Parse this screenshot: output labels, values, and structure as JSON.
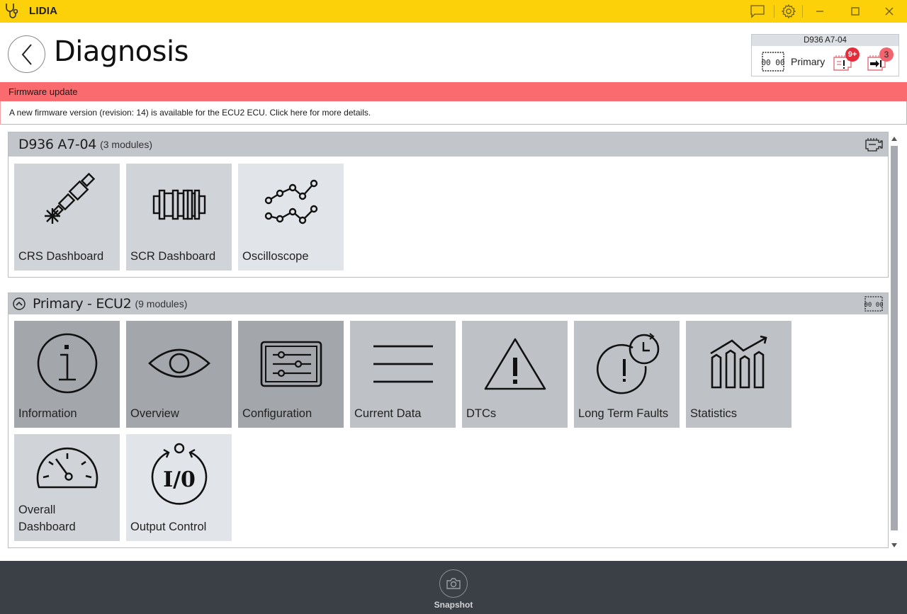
{
  "window": {
    "app_title": "LIDIA",
    "controls": {
      "feedback": "chat-icon",
      "settings": "gear-icon",
      "minimize": "minimize-icon",
      "maximize": "maximize-icon",
      "close": "close-icon"
    }
  },
  "header": {
    "page_title": "Diagnosis",
    "ecu_card": {
      "title": "D936 A7-04",
      "ecu_label": "Primary",
      "fault_badge": "9+",
      "output_badge": "3"
    }
  },
  "firmware_banner": {
    "title": "Firmware update",
    "message": "A new firmware version (revision: 14) is available for the ECU2 ECU. Click here for more details."
  },
  "sections": [
    {
      "title": "D936 A7-04",
      "count": "(3 modules)",
      "tiles": [
        {
          "label": "CRS Dashboard",
          "icon": "injector-icon"
        },
        {
          "label": "SCR Dashboard",
          "icon": "scr-catalyst-icon"
        },
        {
          "label": "Oscilloscope",
          "icon": "oscilloscope-icon"
        }
      ]
    },
    {
      "title": "Primary - ECU2",
      "count": "(9 modules)",
      "tiles": [
        {
          "label": "Information",
          "icon": "info-icon"
        },
        {
          "label": "Overview",
          "icon": "eye-icon"
        },
        {
          "label": "Configuration",
          "icon": "sliders-icon"
        },
        {
          "label": "Current Data",
          "icon": "lines-icon"
        },
        {
          "label": "DTCs",
          "icon": "warning-icon"
        },
        {
          "label": "Long Term Faults",
          "icon": "fault-clock-icon"
        },
        {
          "label": "Statistics",
          "icon": "statistics-icon"
        },
        {
          "label": "Overall Dashboard",
          "icon": "gauge-icon"
        },
        {
          "label": "Output Control",
          "icon": "io-icon"
        }
      ]
    }
  ],
  "footer": {
    "snapshot_label": "Snapshot"
  },
  "colors": {
    "titlebar": "#fdd10a",
    "banner": "#f96b6e",
    "badge": "#e52c3a",
    "footer": "#3b3f46"
  }
}
